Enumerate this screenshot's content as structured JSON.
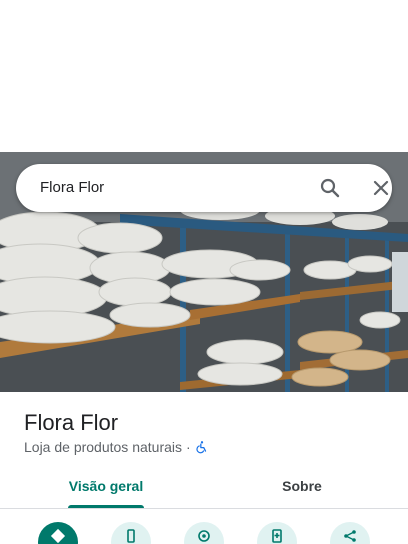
{
  "search": {
    "query": "Flora Flor"
  },
  "place": {
    "name": "Flora Flor",
    "category": "Loja de produtos naturais",
    "separator": "·"
  },
  "tabs": [
    {
      "label": "Visão geral",
      "selected": true
    },
    {
      "label": "Sobre",
      "selected": false
    }
  ],
  "actions": [
    {
      "icon": "directions-icon",
      "primary": true
    },
    {
      "icon": "phone-icon",
      "primary": false
    },
    {
      "icon": "nearby-icon",
      "primary": false
    },
    {
      "icon": "save-icon",
      "primary": false
    },
    {
      "icon": "share-icon",
      "primary": false
    }
  ],
  "colors": {
    "accent": "#00796b",
    "accent_light": "#e0f2f1",
    "accessibility_icon": "#1a73e8"
  }
}
